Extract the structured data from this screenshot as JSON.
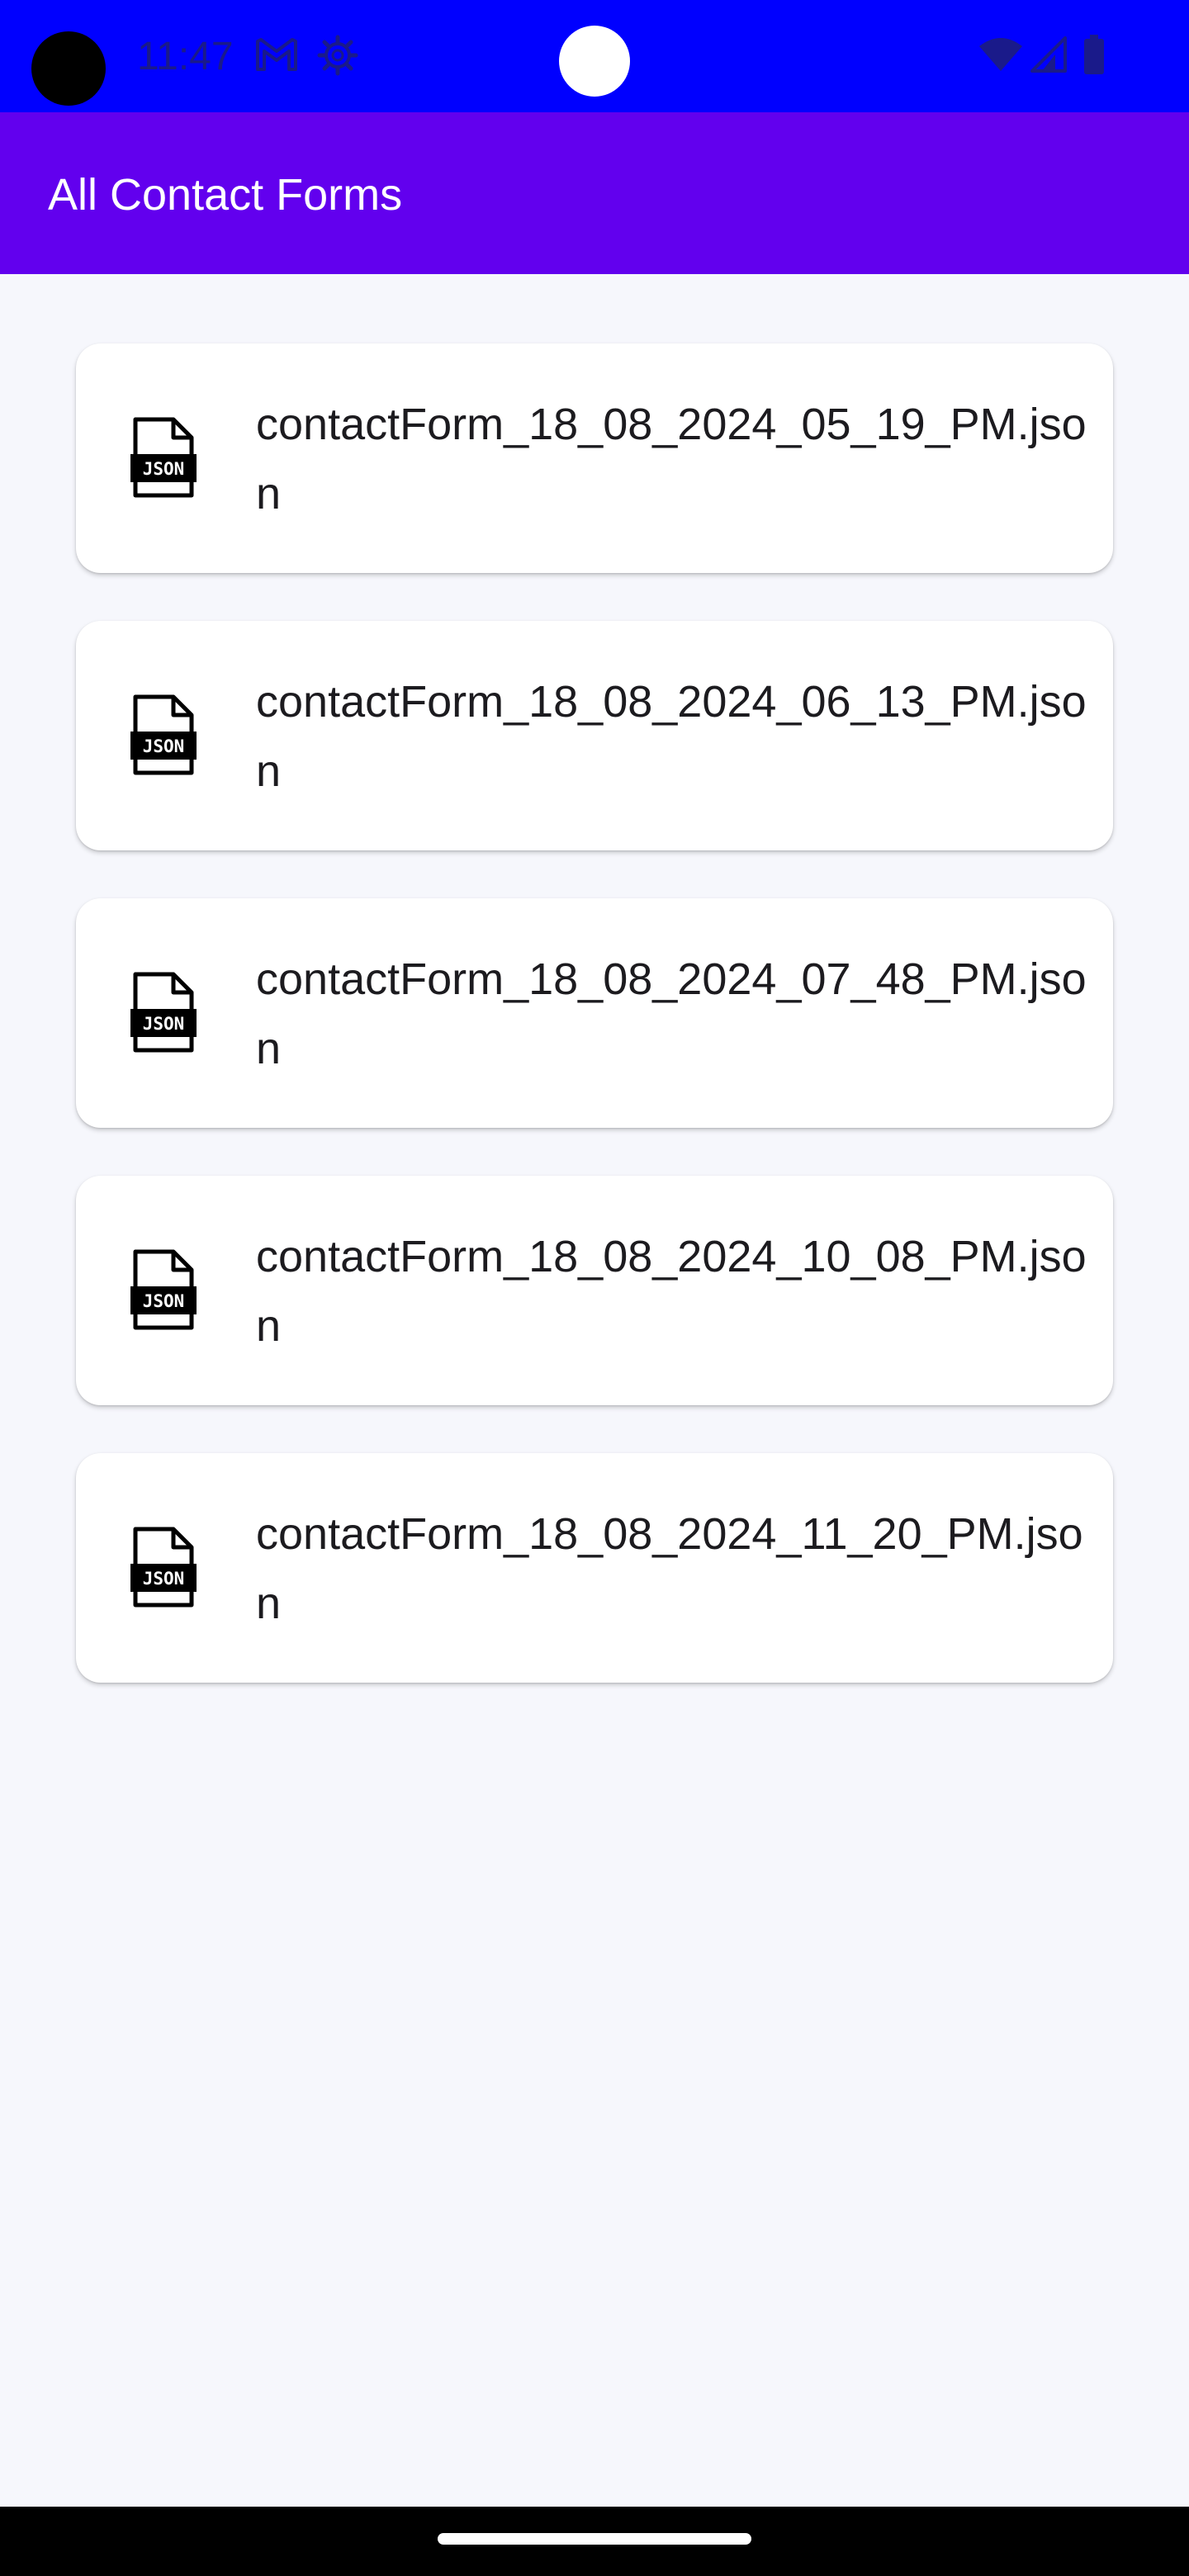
{
  "status_bar": {
    "time": "11:47",
    "icons": [
      "gmail-icon",
      "settings-icon",
      "wifi-icon",
      "signal-icon",
      "battery-icon"
    ]
  },
  "app_bar": {
    "title": "All Contact Forms"
  },
  "files": [
    {
      "name": "contactForm_18_08_2024_05_19_PM.json",
      "icon": "json-file-icon"
    },
    {
      "name": "contactForm_18_08_2024_06_13_PM.json",
      "icon": "json-file-icon"
    },
    {
      "name": "contactForm_18_08_2024_07_48_PM.json",
      "icon": "json-file-icon"
    },
    {
      "name": "contactForm_18_08_2024_10_08_PM.json",
      "icon": "json-file-icon"
    },
    {
      "name": "contactForm_18_08_2024_11_20_PM.json",
      "icon": "json-file-icon"
    }
  ],
  "colors": {
    "status_bar": "#0000FF",
    "app_bar": "#6200EE",
    "background": "#F6F7FC",
    "card": "#FFFFFF"
  }
}
